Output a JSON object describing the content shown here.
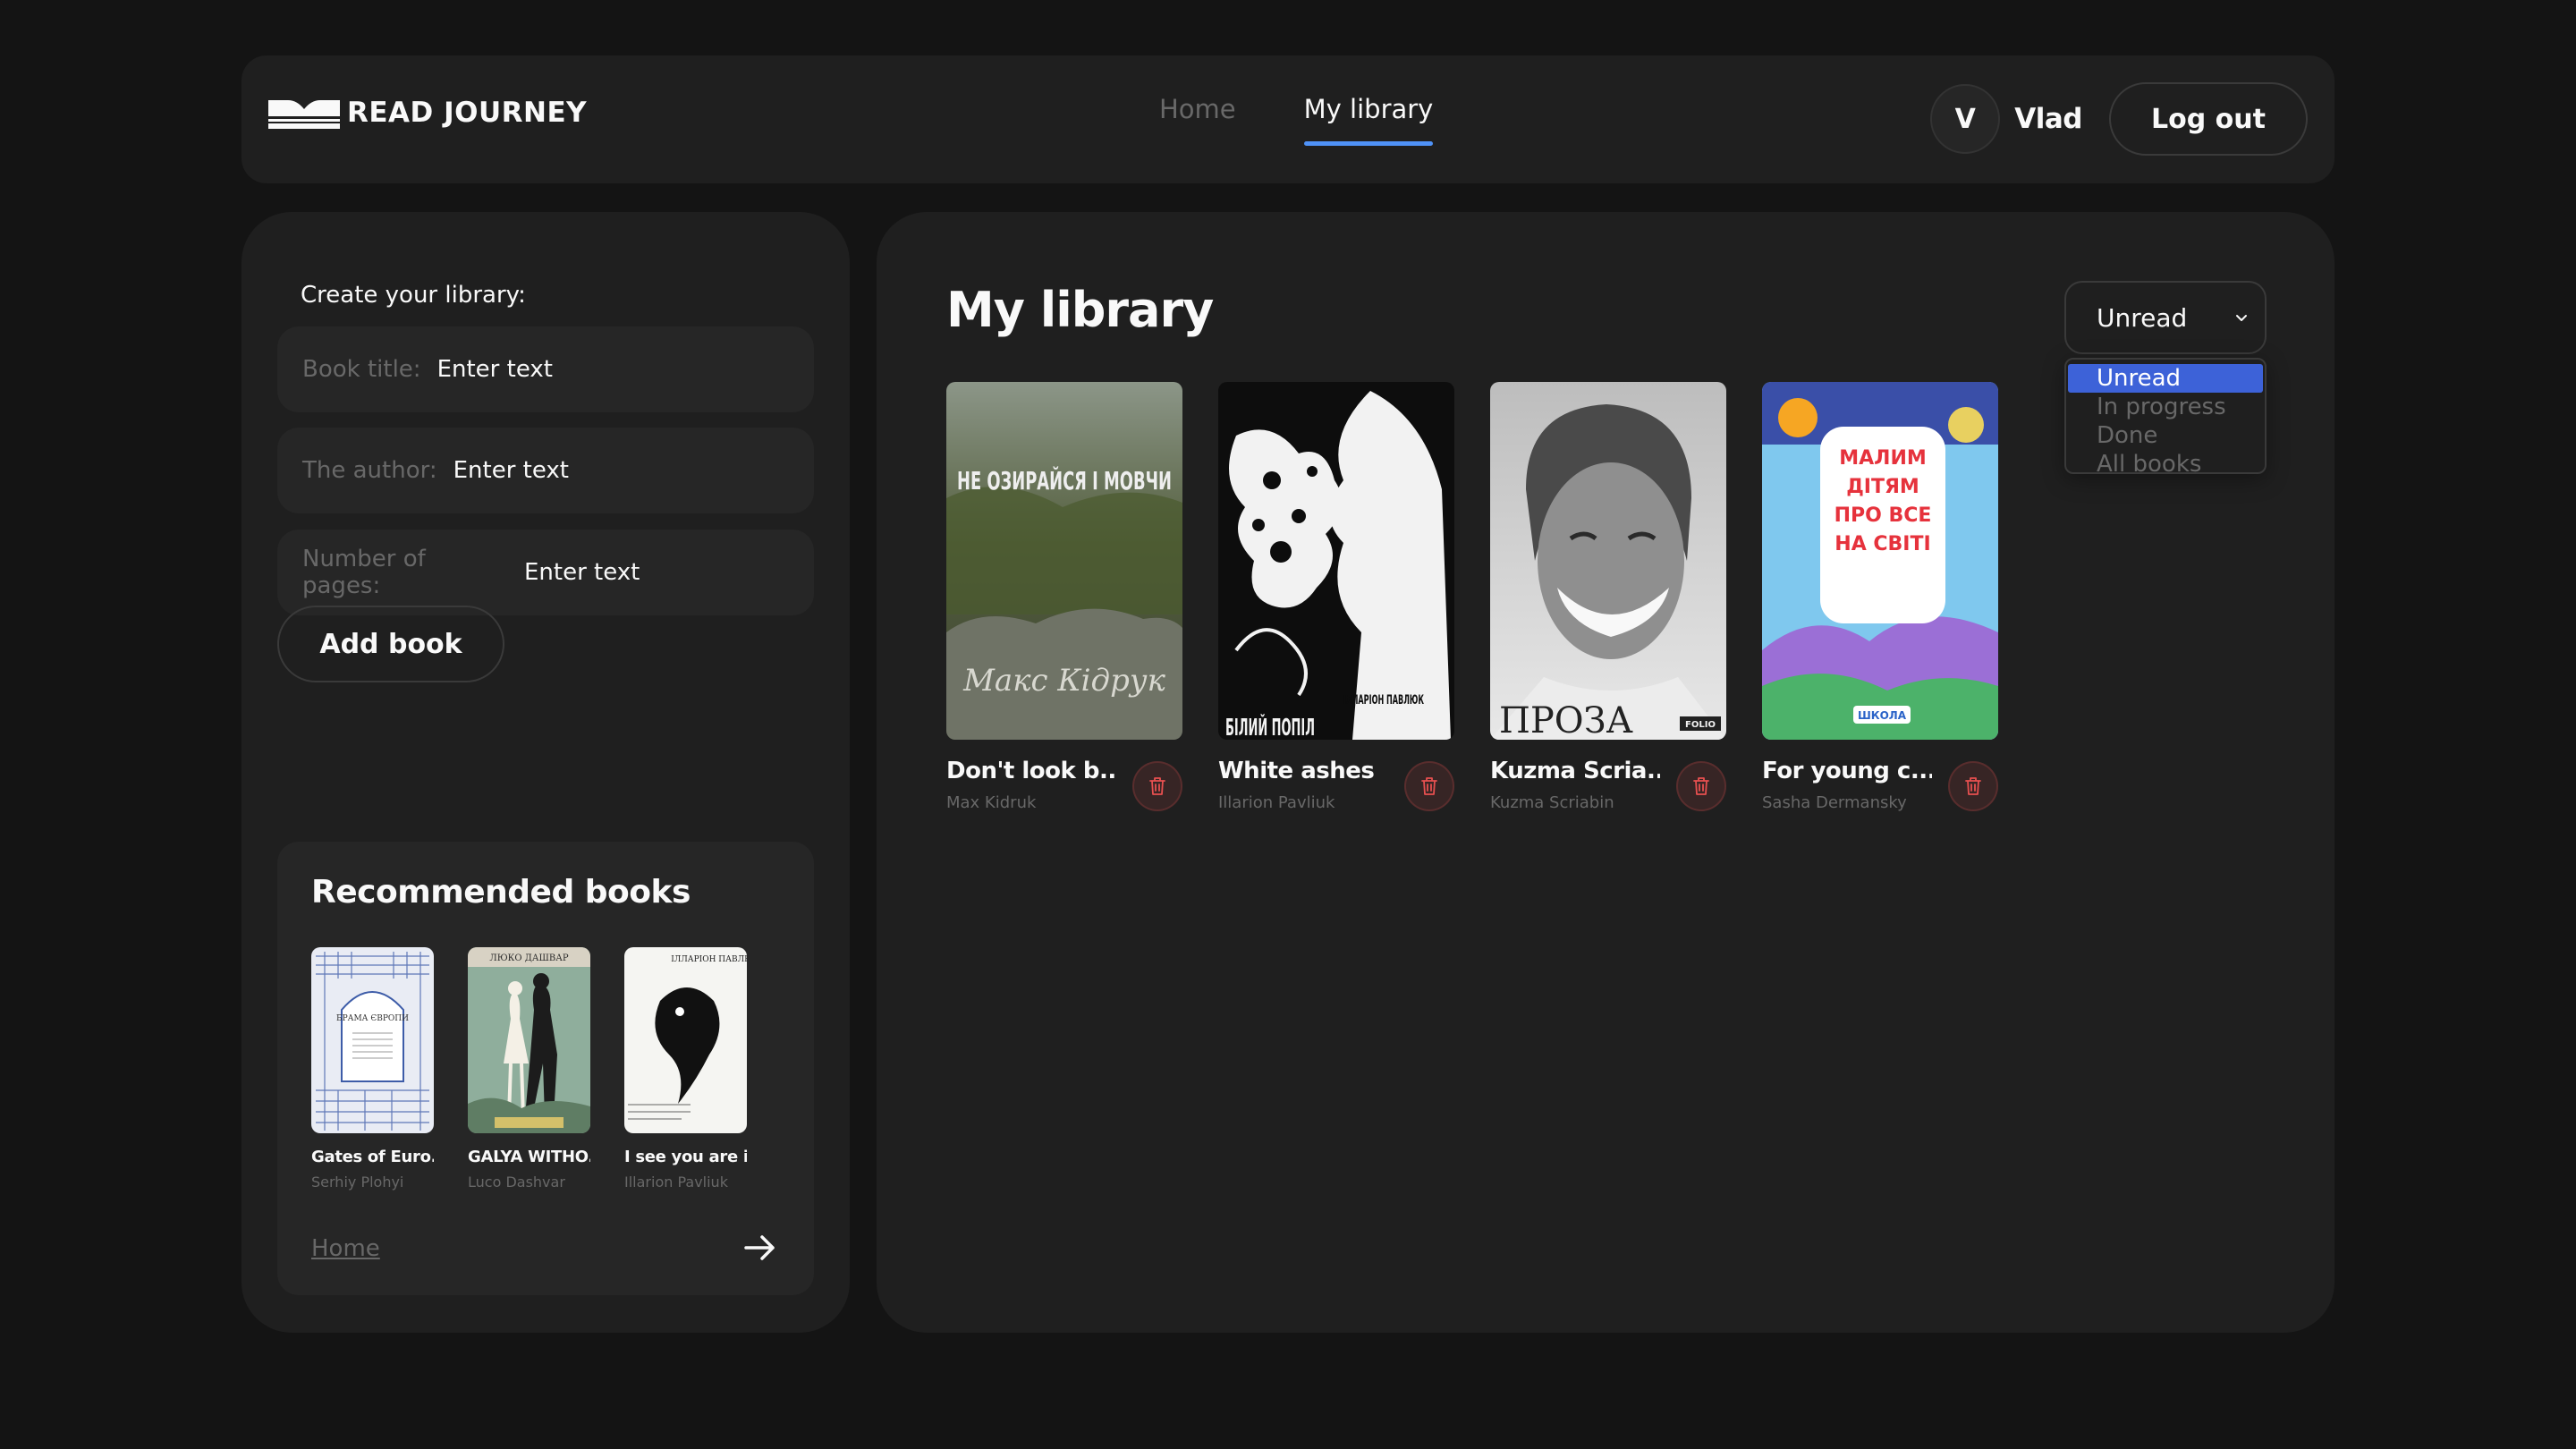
{
  "header": {
    "logo_text": "READ JOURNEY",
    "nav": {
      "home": "Home",
      "library": "My library"
    },
    "user": {
      "initial": "V",
      "name": "Vlad"
    },
    "logout_label": "Log out"
  },
  "form": {
    "title": "Create your library:",
    "fields": [
      {
        "label": "Book title:",
        "placeholder": "Enter text"
      },
      {
        "label": "The author:",
        "placeholder": "Enter text"
      },
      {
        "label": "Number of pages:",
        "placeholder": "Enter text"
      }
    ],
    "add_label": "Add book"
  },
  "recommended": {
    "title": "Recommended books",
    "books": [
      {
        "title": "Gates of Euro...",
        "author": "Serhiy Plohyi",
        "cover_text": "БРАМА ЄВРОПИ"
      },
      {
        "title": "GALYA WITHO...",
        "author": "Luco Dashvar",
        "cover_text": "ЛЮКО ДАШВАР"
      },
      {
        "title": "I see you are i...",
        "author": "Illarion Pavliuk",
        "cover_text": "ІЛЛАРІОН ПАВЛЮК"
      }
    ],
    "home_link": "Home"
  },
  "library": {
    "title": "My library",
    "filter": {
      "selected": "Unread",
      "options": [
        "Unread",
        "In progress",
        "Done",
        "All books"
      ]
    },
    "books": [
      {
        "title": "Don't look b...",
        "author": "Max Kidruk",
        "cover_top": "НЕ ОЗИРАЙСЯ І МОВЧИ",
        "cover_bottom": "Макс Кідрук"
      },
      {
        "title": "White ashes",
        "author": "Illarion Pavliuk",
        "cover_top": "БІЛИЙ ПОПІЛ",
        "cover_bottom": "ІЛЛАРІОН ПАВЛЮК"
      },
      {
        "title": "Kuzma Scria...",
        "author": "Kuzma Scriabin",
        "cover_top": "ПРОЗА",
        "cover_bottom": "FOLIO"
      },
      {
        "title": "For young c...",
        "author": "Sasha Dermansky",
        "cover_top": "МАЛИМ ДІТЯМ ПРО ВСЕ НА СВІТІ",
        "cover_bottom": "ШКОЛА"
      }
    ]
  },
  "colors": {
    "background": "#141414",
    "panel": "#1f1f1f",
    "field": "#262626",
    "accent": "#4f92f7",
    "selected_option": "#3d62d8",
    "muted": "#686868",
    "danger": "#e85050"
  }
}
